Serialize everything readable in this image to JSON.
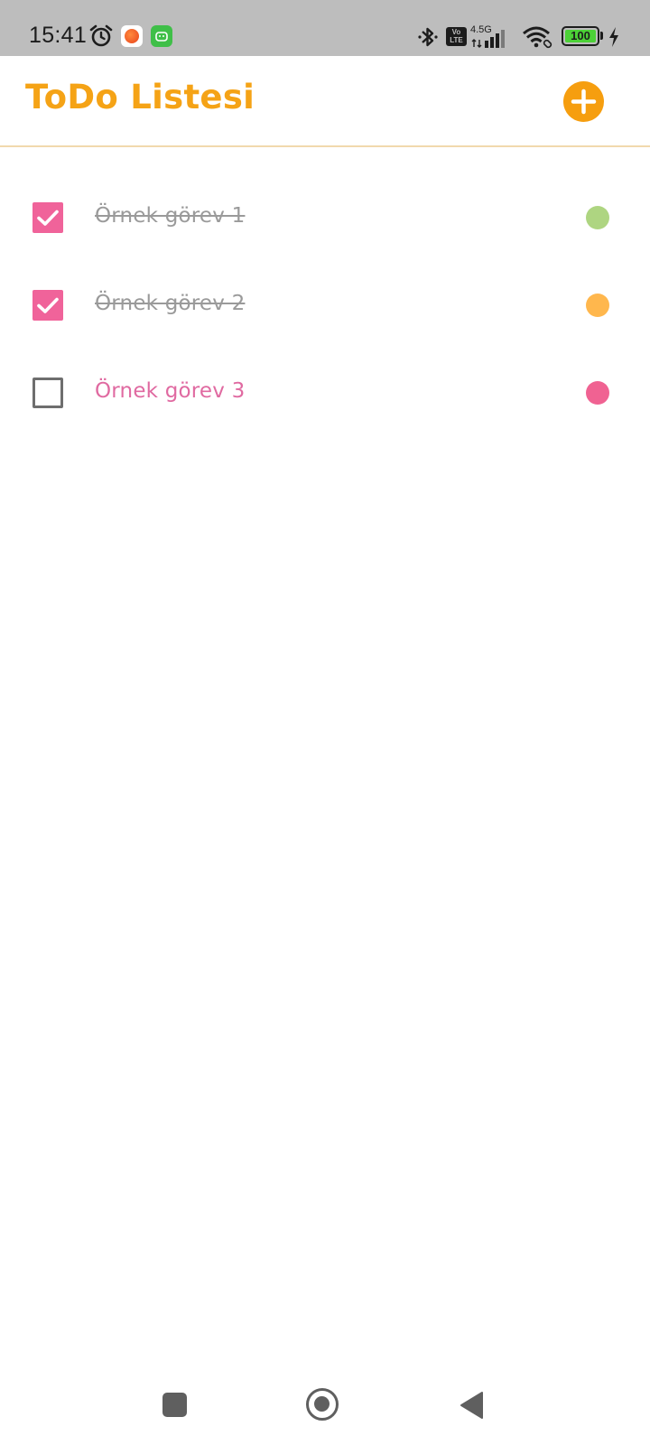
{
  "status_bar": {
    "time": "15:41",
    "network_generation": "4.5G",
    "volte_top": "Vo",
    "volte_bottom": "LTE",
    "battery_level": "100",
    "icons": [
      "alarm-icon",
      "app-notification-icon",
      "android-notification-icon",
      "bluetooth-icon",
      "volte-icon",
      "signal-icon",
      "wifi-icon",
      "battery-icon",
      "charging-icon"
    ]
  },
  "app_bar": {
    "title": "ToDo Listesi",
    "add_icon": "plus-circle-icon",
    "title_color": "#f5a316",
    "accent_color": "#f69e0f"
  },
  "tasks": [
    {
      "label": "Örnek görev 1",
      "completed": true,
      "priority_color": "#aed581"
    },
    {
      "label": "Örnek görev 2",
      "completed": true,
      "priority_color": "#ffb74d"
    },
    {
      "label": "Örnek görev 3",
      "completed": false,
      "priority_color": "#f06292"
    }
  ],
  "nav_bar": {
    "icons": [
      "recents-icon",
      "home-icon",
      "back-icon"
    ]
  }
}
